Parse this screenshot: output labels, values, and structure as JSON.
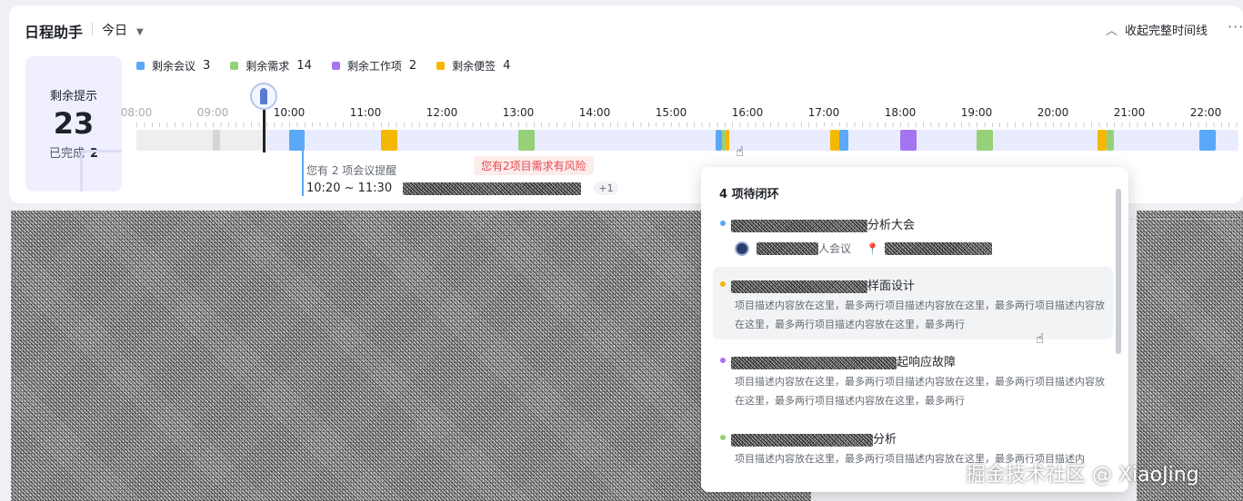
{
  "header": {
    "title": "日程助手",
    "day_selector": "今日",
    "collapse_label": "收起完整时间线",
    "more_label": "···"
  },
  "remaining": {
    "label": "剩余提示",
    "count": "23",
    "done_label": "已完成",
    "done_count": "2"
  },
  "legend": [
    {
      "label": "剩余会议",
      "count": "3",
      "color": "#5aa8f7"
    },
    {
      "label": "剩余需求",
      "count": "14",
      "color": "#96d17a"
    },
    {
      "label": "剩余工作项",
      "count": "2",
      "color": "#a574f0"
    },
    {
      "label": "剩余便签",
      "count": "4",
      "color": "#f5b800"
    }
  ],
  "timeline": {
    "hours": [
      "08:00",
      "09:00",
      "10:00",
      "11:00",
      "12:00",
      "13:00",
      "14:00",
      "15:00",
      "16:00",
      "17:00",
      "18:00",
      "19:00",
      "20:00",
      "21:00",
      "22:00"
    ],
    "past_until": "09:40",
    "now": "09:40",
    "events": [
      {
        "start": "09:00",
        "end": "09:06",
        "kind": "past"
      },
      {
        "start": "10:00",
        "end": "10:12",
        "kind": "meeting"
      },
      {
        "start": "11:12",
        "end": "11:25",
        "kind": "note"
      },
      {
        "start": "13:00",
        "end": "13:13",
        "kind": "demand"
      },
      {
        "start": "15:35",
        "end": "15:40",
        "kind": "meeting"
      },
      {
        "start": "15:40",
        "end": "15:43",
        "kind": "demand"
      },
      {
        "start": "15:43",
        "end": "15:46",
        "kind": "note"
      },
      {
        "start": "17:05",
        "end": "17:12",
        "kind": "note"
      },
      {
        "start": "17:12",
        "end": "17:19",
        "kind": "meeting"
      },
      {
        "start": "18:00",
        "end": "18:13",
        "kind": "work"
      },
      {
        "start": "19:00",
        "end": "19:13",
        "kind": "demand"
      },
      {
        "start": "20:35",
        "end": "20:42",
        "kind": "note"
      },
      {
        "start": "20:42",
        "end": "20:48",
        "kind": "demand"
      },
      {
        "start": "21:55",
        "end": "22:08",
        "kind": "meeting"
      }
    ]
  },
  "reminder": {
    "text": "您有 2 项会议提醒",
    "time": "10:20 ~ 11:30",
    "more": "+1"
  },
  "risk_tag": "您有2项目需求有风险",
  "popover": {
    "title": "4 项待闭环",
    "items": [
      {
        "name_tail": "分析大会",
        "color": "#5aa8f7",
        "meta_tail": "人会议",
        "type": "meeting"
      },
      {
        "name_tail": "样面设计",
        "color": "#f5b800",
        "desc": "项目描述内容放在这里，最多两行项目描述内容放在这里，最多两行项目描述内容放在这里，最多两行项目描述内容放在这里，最多两行",
        "type": "note"
      },
      {
        "name_tail": "起响应故障",
        "color": "#a574f0",
        "desc": "项目描述内容放在这里，最多两行项目描述内容放在这里，最多两行项目描述内容放在这里，最多两行项目描述内容放在这里，最多两行",
        "type": "work"
      },
      {
        "name_tail": "分析",
        "color": "#96d17a",
        "desc": "项目描述内容放在这里，最多两行项目描述内容放在这里，最多两行项目描述内",
        "type": "demand"
      }
    ]
  },
  "watermark": "掘金技术社区 @ XiaoJing",
  "kind_colors": {
    "meeting": "#5aa8f7",
    "demand": "#96d17a",
    "work": "#a574f0",
    "note": "#f5b800",
    "past": "#d5d5d5"
  }
}
